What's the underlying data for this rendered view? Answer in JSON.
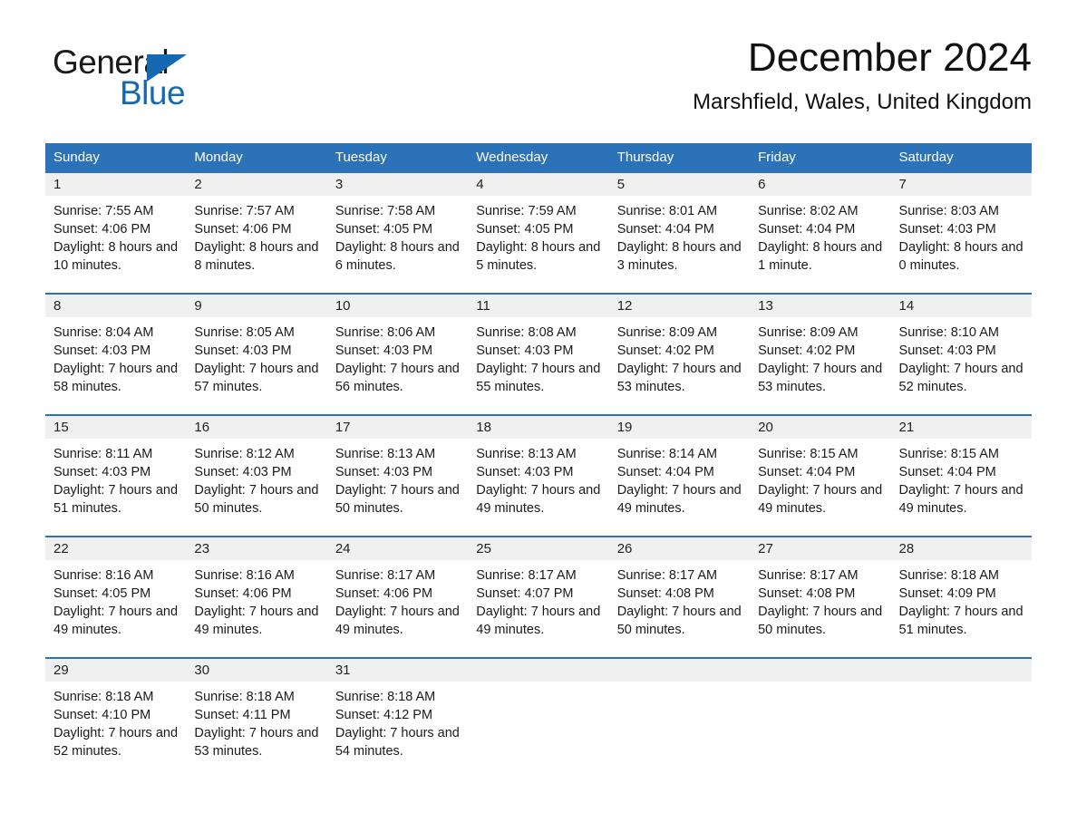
{
  "brand": {
    "name_part1": "General",
    "name_part2": "Blue",
    "triangle_color": "#1569b0"
  },
  "header": {
    "title": "December 2024",
    "location": "Marshfield, Wales, United Kingdom"
  },
  "theme": {
    "header_blue": "#2c72b8",
    "day_band_gray": "#f0f0f0",
    "text_color": "#1a1a1a"
  },
  "weekdays": [
    "Sunday",
    "Monday",
    "Tuesday",
    "Wednesday",
    "Thursday",
    "Friday",
    "Saturday"
  ],
  "weeks": [
    [
      {
        "day": "1",
        "sunrise": "Sunrise: 7:55 AM",
        "sunset": "Sunset: 4:06 PM",
        "daylight": "Daylight: 8 hours and 10 minutes."
      },
      {
        "day": "2",
        "sunrise": "Sunrise: 7:57 AM",
        "sunset": "Sunset: 4:06 PM",
        "daylight": "Daylight: 8 hours and 8 minutes."
      },
      {
        "day": "3",
        "sunrise": "Sunrise: 7:58 AM",
        "sunset": "Sunset: 4:05 PM",
        "daylight": "Daylight: 8 hours and 6 minutes."
      },
      {
        "day": "4",
        "sunrise": "Sunrise: 7:59 AM",
        "sunset": "Sunset: 4:05 PM",
        "daylight": "Daylight: 8 hours and 5 minutes."
      },
      {
        "day": "5",
        "sunrise": "Sunrise: 8:01 AM",
        "sunset": "Sunset: 4:04 PM",
        "daylight": "Daylight: 8 hours and 3 minutes."
      },
      {
        "day": "6",
        "sunrise": "Sunrise: 8:02 AM",
        "sunset": "Sunset: 4:04 PM",
        "daylight": "Daylight: 8 hours and 1 minute."
      },
      {
        "day": "7",
        "sunrise": "Sunrise: 8:03 AM",
        "sunset": "Sunset: 4:03 PM",
        "daylight": "Daylight: 8 hours and 0 minutes."
      }
    ],
    [
      {
        "day": "8",
        "sunrise": "Sunrise: 8:04 AM",
        "sunset": "Sunset: 4:03 PM",
        "daylight": "Daylight: 7 hours and 58 minutes."
      },
      {
        "day": "9",
        "sunrise": "Sunrise: 8:05 AM",
        "sunset": "Sunset: 4:03 PM",
        "daylight": "Daylight: 7 hours and 57 minutes."
      },
      {
        "day": "10",
        "sunrise": "Sunrise: 8:06 AM",
        "sunset": "Sunset: 4:03 PM",
        "daylight": "Daylight: 7 hours and 56 minutes."
      },
      {
        "day": "11",
        "sunrise": "Sunrise: 8:08 AM",
        "sunset": "Sunset: 4:03 PM",
        "daylight": "Daylight: 7 hours and 55 minutes."
      },
      {
        "day": "12",
        "sunrise": "Sunrise: 8:09 AM",
        "sunset": "Sunset: 4:02 PM",
        "daylight": "Daylight: 7 hours and 53 minutes."
      },
      {
        "day": "13",
        "sunrise": "Sunrise: 8:09 AM",
        "sunset": "Sunset: 4:02 PM",
        "daylight": "Daylight: 7 hours and 53 minutes."
      },
      {
        "day": "14",
        "sunrise": "Sunrise: 8:10 AM",
        "sunset": "Sunset: 4:03 PM",
        "daylight": "Daylight: 7 hours and 52 minutes."
      }
    ],
    [
      {
        "day": "15",
        "sunrise": "Sunrise: 8:11 AM",
        "sunset": "Sunset: 4:03 PM",
        "daylight": "Daylight: 7 hours and 51 minutes."
      },
      {
        "day": "16",
        "sunrise": "Sunrise: 8:12 AM",
        "sunset": "Sunset: 4:03 PM",
        "daylight": "Daylight: 7 hours and 50 minutes."
      },
      {
        "day": "17",
        "sunrise": "Sunrise: 8:13 AM",
        "sunset": "Sunset: 4:03 PM",
        "daylight": "Daylight: 7 hours and 50 minutes."
      },
      {
        "day": "18",
        "sunrise": "Sunrise: 8:13 AM",
        "sunset": "Sunset: 4:03 PM",
        "daylight": "Daylight: 7 hours and 49 minutes."
      },
      {
        "day": "19",
        "sunrise": "Sunrise: 8:14 AM",
        "sunset": "Sunset: 4:04 PM",
        "daylight": "Daylight: 7 hours and 49 minutes."
      },
      {
        "day": "20",
        "sunrise": "Sunrise: 8:15 AM",
        "sunset": "Sunset: 4:04 PM",
        "daylight": "Daylight: 7 hours and 49 minutes."
      },
      {
        "day": "21",
        "sunrise": "Sunrise: 8:15 AM",
        "sunset": "Sunset: 4:04 PM",
        "daylight": "Daylight: 7 hours and 49 minutes."
      }
    ],
    [
      {
        "day": "22",
        "sunrise": "Sunrise: 8:16 AM",
        "sunset": "Sunset: 4:05 PM",
        "daylight": "Daylight: 7 hours and 49 minutes."
      },
      {
        "day": "23",
        "sunrise": "Sunrise: 8:16 AM",
        "sunset": "Sunset: 4:06 PM",
        "daylight": "Daylight: 7 hours and 49 minutes."
      },
      {
        "day": "24",
        "sunrise": "Sunrise: 8:17 AM",
        "sunset": "Sunset: 4:06 PM",
        "daylight": "Daylight: 7 hours and 49 minutes."
      },
      {
        "day": "25",
        "sunrise": "Sunrise: 8:17 AM",
        "sunset": "Sunset: 4:07 PM",
        "daylight": "Daylight: 7 hours and 49 minutes."
      },
      {
        "day": "26",
        "sunrise": "Sunrise: 8:17 AM",
        "sunset": "Sunset: 4:08 PM",
        "daylight": "Daylight: 7 hours and 50 minutes."
      },
      {
        "day": "27",
        "sunrise": "Sunrise: 8:17 AM",
        "sunset": "Sunset: 4:08 PM",
        "daylight": "Daylight: 7 hours and 50 minutes."
      },
      {
        "day": "28",
        "sunrise": "Sunrise: 8:18 AM",
        "sunset": "Sunset: 4:09 PM",
        "daylight": "Daylight: 7 hours and 51 minutes."
      }
    ],
    [
      {
        "day": "29",
        "sunrise": "Sunrise: 8:18 AM",
        "sunset": "Sunset: 4:10 PM",
        "daylight": "Daylight: 7 hours and 52 minutes."
      },
      {
        "day": "30",
        "sunrise": "Sunrise: 8:18 AM",
        "sunset": "Sunset: 4:11 PM",
        "daylight": "Daylight: 7 hours and 53 minutes."
      },
      {
        "day": "31",
        "sunrise": "Sunrise: 8:18 AM",
        "sunset": "Sunset: 4:12 PM",
        "daylight": "Daylight: 7 hours and 54 minutes."
      },
      {
        "day": "",
        "sunrise": "",
        "sunset": "",
        "daylight": ""
      },
      {
        "day": "",
        "sunrise": "",
        "sunset": "",
        "daylight": ""
      },
      {
        "day": "",
        "sunrise": "",
        "sunset": "",
        "daylight": ""
      },
      {
        "day": "",
        "sunrise": "",
        "sunset": "",
        "daylight": ""
      }
    ]
  ]
}
